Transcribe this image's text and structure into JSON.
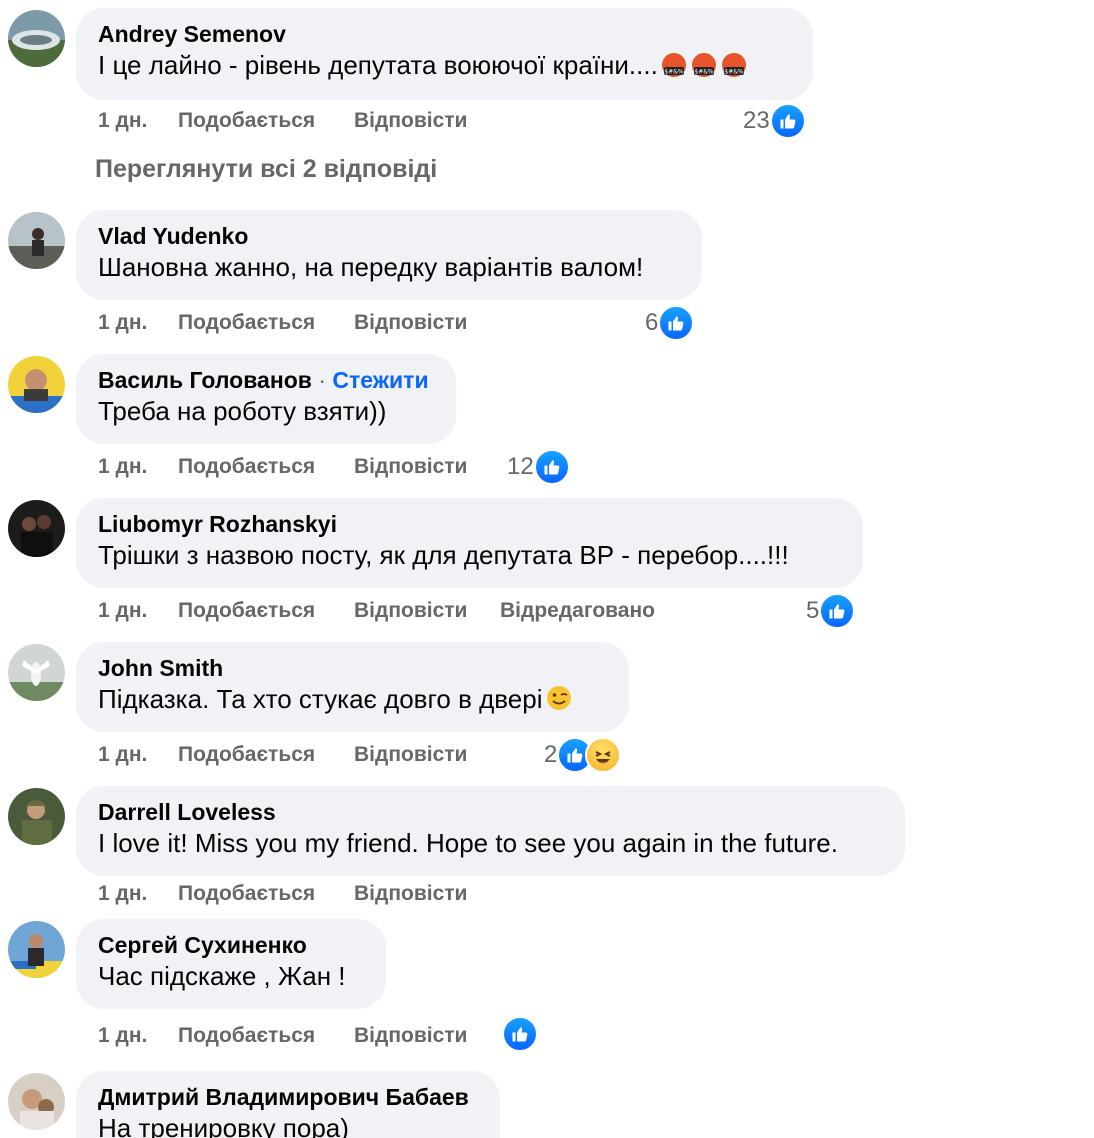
{
  "actions": {
    "time": "1 дн.",
    "like": "Подобається",
    "reply": "Відповісти",
    "edited": "Відредаговано"
  },
  "view_replies": "Переглянути всі 2 відповіді",
  "follow_label": "Стежити",
  "follow_separator": "·",
  "comments": [
    {
      "author": "Andrey Semenov",
      "text": "І це лайно - рівень депутата воюючої країни....",
      "reaction_count": "23"
    },
    {
      "author": "Vlad Yudenko",
      "text": "Шановна жанно, на передку варіантів валом!",
      "reaction_count": "6"
    },
    {
      "author": "Василь Голованов",
      "text": "Треба на роботу взяти))",
      "reaction_count": "12"
    },
    {
      "author": "Liubomyr Rozhanskyi",
      "text": "Трішки з назвою посту, як для депутата ВР - перебор....!!!",
      "reaction_count": "5"
    },
    {
      "author": "John Smith",
      "text": "Підказка. Та хто стукає довго в двері",
      "reaction_count": "2"
    },
    {
      "author": "Darrell Loveless",
      "text": "I love it! Miss you my friend. Hope to see you again in the future."
    },
    {
      "author": "Сергей Сухиненко",
      "text": "Час підскаже , Жан !"
    },
    {
      "author": "Дмитрий Владимирович Бабаев",
      "text": "На тренировку пора)"
    }
  ],
  "colors": {
    "bubble": "#f0f2f5",
    "secondary_text": "#65676b",
    "link_blue": "#0866ff",
    "like_gradient_top": "#18a0fb"
  },
  "icons": {
    "like": "thumbs-up-icon",
    "haha": "laughing-face-icon",
    "swearing": "face-with-symbols-on-mouth-icon",
    "wink": "winking-face-icon"
  }
}
